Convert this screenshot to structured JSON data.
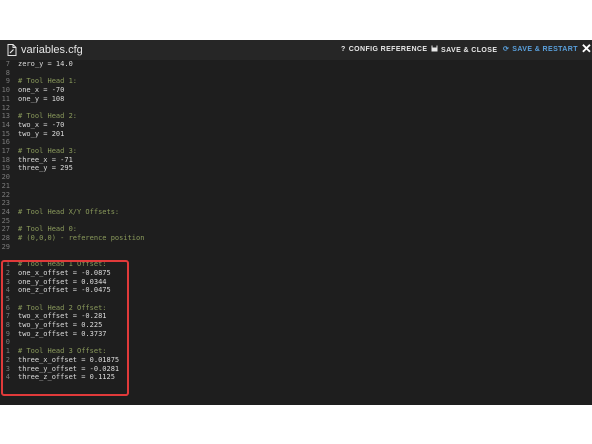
{
  "dialog": {
    "file_name": "variables.cfg",
    "icons": {
      "file": "file-edit-icon",
      "help": "question-icon",
      "save": "floppy-icon",
      "restart": "restart-icon",
      "close": "close-icon"
    },
    "buttons": {
      "config_reference": "CONFIG REFERENCE",
      "save_close": "SAVE & CLOSE",
      "save_restart": "SAVE & RESTART"
    },
    "colors": {
      "accent": "#5aa0dc",
      "highlight": "#e03a3a",
      "comment": "#8a9a5b"
    }
  },
  "editor": {
    "lines": [
      {
        "n": "7",
        "text": "zero_y = 14.0",
        "comment": false
      },
      {
        "n": "8",
        "text": "",
        "comment": false
      },
      {
        "n": "9",
        "text": "# Tool Head 1:",
        "comment": true
      },
      {
        "n": "10",
        "text": "one_x = -70",
        "comment": false
      },
      {
        "n": "11",
        "text": "one_y = 108",
        "comment": false
      },
      {
        "n": "12",
        "text": "",
        "comment": false
      },
      {
        "n": "13",
        "text": "# Tool Head 2:",
        "comment": true
      },
      {
        "n": "14",
        "text": "two_x = -70",
        "comment": false
      },
      {
        "n": "15",
        "text": "two_y = 201",
        "comment": false
      },
      {
        "n": "16",
        "text": "",
        "comment": false
      },
      {
        "n": "17",
        "text": "# Tool Head 3:",
        "comment": true
      },
      {
        "n": "18",
        "text": "three_x = -71",
        "comment": false
      },
      {
        "n": "19",
        "text": "three_y = 295",
        "comment": false
      },
      {
        "n": "20",
        "text": "",
        "comment": false
      },
      {
        "n": "21",
        "text": "",
        "comment": false
      },
      {
        "n": "22",
        "text": "",
        "comment": false
      },
      {
        "n": "23",
        "text": "",
        "comment": false
      },
      {
        "n": "24",
        "text": "# Tool Head X/Y Offsets:",
        "comment": true
      },
      {
        "n": "25",
        "text": "",
        "comment": false
      },
      {
        "n": "27",
        "text": "# Tool Head 0:",
        "comment": true
      },
      {
        "n": "28",
        "text": "# (0,0,0) - reference position",
        "comment": true
      },
      {
        "n": "29",
        "text": "",
        "comment": false
      },
      {
        "n": "",
        "text": "",
        "comment": false
      },
      {
        "n": "1",
        "text": "# Tool Head 1 Offset:",
        "comment": true
      },
      {
        "n": "2",
        "text": "one_x_offset = -0.0875",
        "comment": false
      },
      {
        "n": "3",
        "text": "one_y_offset = 0.0344",
        "comment": false
      },
      {
        "n": "4",
        "text": "one_z_offset = -0.0475",
        "comment": false
      },
      {
        "n": "5",
        "text": "",
        "comment": false
      },
      {
        "n": "6",
        "text": "# Tool Head 2 Offset:",
        "comment": true
      },
      {
        "n": "7",
        "text": "two_x_offset = -0.281",
        "comment": false
      },
      {
        "n": "8",
        "text": "two_y_offset = 0.225",
        "comment": false
      },
      {
        "n": "9",
        "text": "two_z_offset = 0.3737",
        "comment": false
      },
      {
        "n": "0",
        "text": "",
        "comment": false
      },
      {
        "n": "1",
        "text": "# Tool Head 3 Offset:",
        "comment": true
      },
      {
        "n": "2",
        "text": "three_x_offset = 0.01875",
        "comment": false
      },
      {
        "n": "3",
        "text": "three_y_offset = -0.0281",
        "comment": false
      },
      {
        "n": "4",
        "text": "three_z_offset = 0.1125",
        "comment": false
      }
    ]
  }
}
